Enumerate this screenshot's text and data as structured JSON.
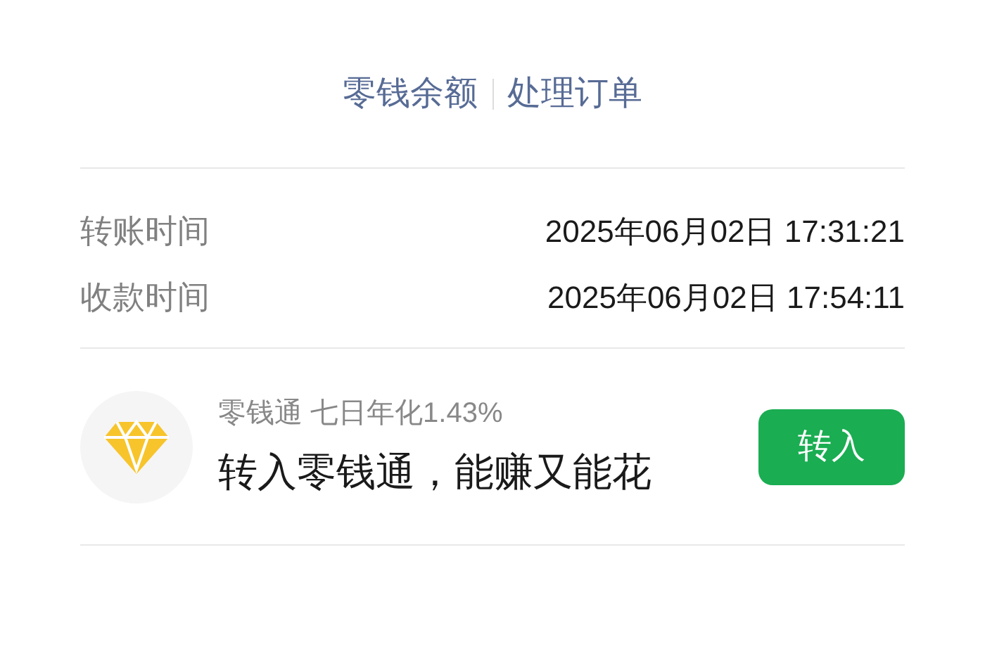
{
  "links": [
    "零钱余额",
    "处理订单"
  ],
  "details": [
    {
      "label": "转账时间",
      "value": "2025年06月02日 17:31:21"
    },
    {
      "label": "收款时间",
      "value": "2025年06月02日 17:54:11"
    }
  ],
  "promo": {
    "title": "零钱通 七日年化1.43%",
    "subtitle": "转入零钱通，能赚又能花",
    "button": "转入"
  }
}
